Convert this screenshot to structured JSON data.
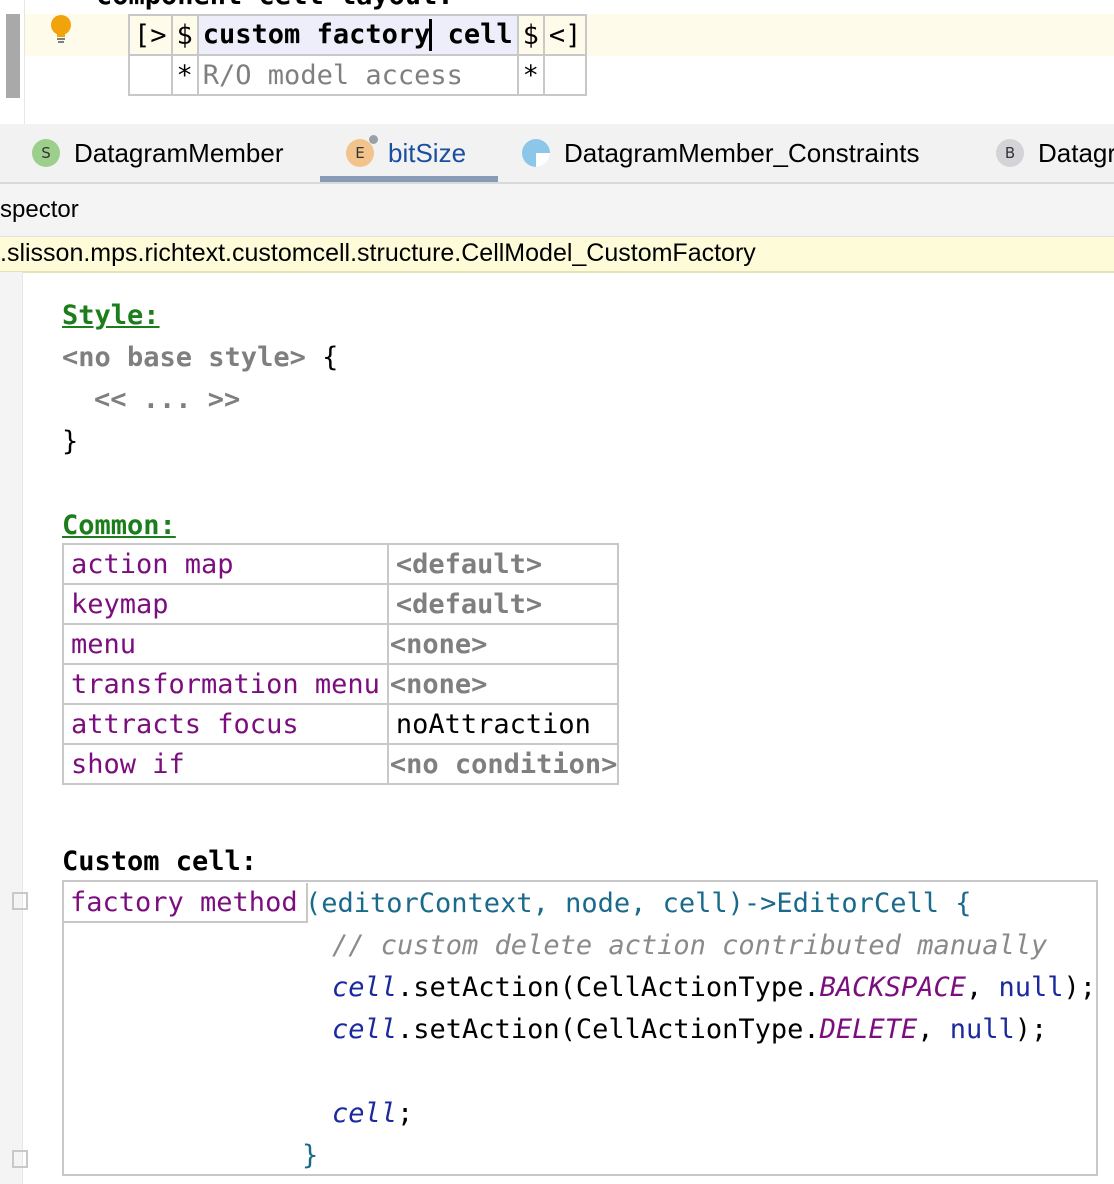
{
  "top_editor": {
    "heading": "component cell layout:",
    "row1": {
      "open": "[>",
      "dollar_left": "$",
      "cell_before_caret": "custom factory",
      "cell_after_caret": " cell",
      "dollar_right": "$",
      "close": "<]"
    },
    "row2": {
      "star_left": "*",
      "value": "R/O model access",
      "star_right": "*"
    }
  },
  "tabs": [
    {
      "icon_letter": "S",
      "label": "DatagramMember",
      "icon_color": "#9ccf8c",
      "active": false
    },
    {
      "icon_letter": "E",
      "label": "bitSize",
      "icon_color": "#f2c48c",
      "active": true
    },
    {
      "icon_letter": "",
      "label": "DatagramMember_Constraints",
      "icon_color": "#8cc6e8",
      "active": false
    },
    {
      "icon_letter": "B",
      "label": "Datagr",
      "icon_color": "#d4d4d8",
      "active": false
    }
  ],
  "inspector": {
    "title": "spector",
    "concept": ".slisson.mps.richtext.customcell.structure.CellModel_CustomFactory"
  },
  "style_section": {
    "heading": "Style:",
    "base": "<no base style>",
    "open_brace": "{",
    "placeholder": "<< ... >>",
    "close_brace": "}"
  },
  "common_section": {
    "heading": "Common:",
    "rows": [
      {
        "key": "action map",
        "value": "<default>",
        "kind": "default"
      },
      {
        "key": "keymap",
        "value": "<default>",
        "kind": "default"
      },
      {
        "key": "menu",
        "value": "<none>",
        "kind": "default"
      },
      {
        "key": "transformation menu",
        "value": "<none>",
        "kind": "default"
      },
      {
        "key": "attracts focus",
        "value": "noAttraction",
        "kind": "plain"
      },
      {
        "key": "show if",
        "value": "<no condition>",
        "kind": "default"
      }
    ]
  },
  "custom_cell": {
    "heading": "Custom cell:",
    "factory_label": "factory method",
    "signature": "(editorContext, node, cell)->EditorCell {",
    "comment": "// custom delete action contributed manually",
    "line1": {
      "var": "cell",
      "call": ".setAction(CellActionType.",
      "const": "BACKSPACE",
      "sep": ", ",
      "null": "null",
      "end": ");"
    },
    "line2": {
      "var": "cell",
      "call": ".setAction(CellActionType.",
      "const": "DELETE",
      "sep": ", ",
      "null": "null",
      "end": ");"
    },
    "return_line": {
      "var": "cell",
      "end": ";"
    },
    "close_brace": "}"
  },
  "colors": {
    "section_heading": "#1b7d1b",
    "property_key": "#7b0d7e",
    "concept_bar": "#fdfbd8",
    "caret_line": "#fefbea"
  }
}
